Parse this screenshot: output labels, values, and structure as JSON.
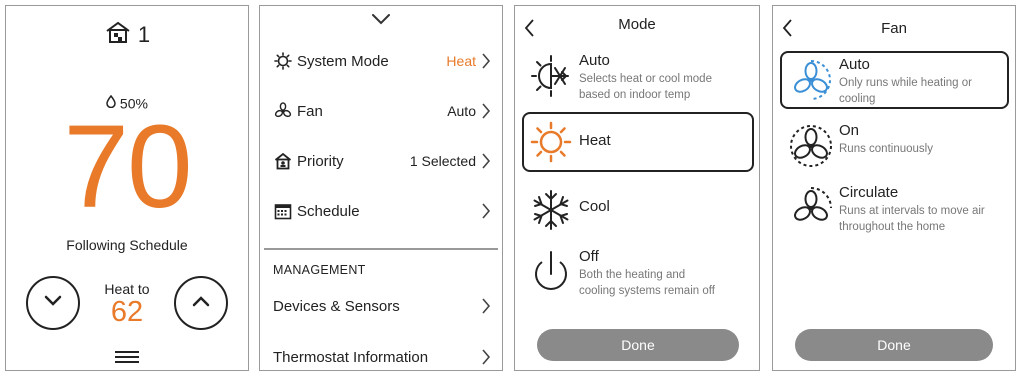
{
  "home": {
    "zone_number": "1",
    "humidity": "50%",
    "temperature": "70",
    "schedule_status": "Following Schedule",
    "mode_label": "Heat to",
    "setpoint": "62",
    "icons": [
      "home-zone-icon",
      "humidity-drop-icon",
      "chevron-down-icon",
      "chevron-up-icon",
      "menu-icon"
    ]
  },
  "settings": {
    "items": [
      {
        "label": "System Mode",
        "value": "Heat",
        "icon": "sun-gear-icon"
      },
      {
        "label": "Fan",
        "value": "Auto",
        "icon": "fan-icon"
      },
      {
        "label": "Priority",
        "value": "1 Selected",
        "icon": "home-priority-icon"
      },
      {
        "label": "Schedule",
        "value": "",
        "icon": "calendar-icon"
      }
    ],
    "section_header": "MANAGEMENT",
    "management_items": [
      {
        "label": "Devices & Sensors"
      },
      {
        "label": "Thermostat Information"
      }
    ]
  },
  "mode": {
    "title": "Mode",
    "selected": "Heat",
    "options": [
      {
        "name": "Auto",
        "desc_line1": "Selects heat or cool mode",
        "desc_line2": "based on indoor temp",
        "icon": "auto-mode-icon"
      },
      {
        "name": "Heat",
        "desc_line1": "",
        "desc_line2": "",
        "icon": "sun-icon"
      },
      {
        "name": "Cool",
        "desc_line1": "",
        "desc_line2": "",
        "icon": "snowflake-icon"
      },
      {
        "name": "Off",
        "desc_line1": "Both the heating and",
        "desc_line2": "cooling systems remain off",
        "icon": "power-icon"
      }
    ],
    "done_label": "Done"
  },
  "fan": {
    "title": "Fan",
    "selected": "Auto",
    "options": [
      {
        "name": "Auto",
        "desc_line1": "Only runs while heating or",
        "desc_line2": "cooling",
        "icon": "fan-auto-icon"
      },
      {
        "name": "On",
        "desc_line1": "Runs continuously",
        "desc_line2": "",
        "icon": "fan-on-icon"
      },
      {
        "name": "Circulate",
        "desc_line1": "Runs at intervals to move air",
        "desc_line2": "throughout the home",
        "icon": "fan-circulate-icon"
      }
    ],
    "done_label": "Done"
  },
  "colors": {
    "accent_orange": "#e87a2a",
    "fan_blue": "#3a8fd6",
    "done_gray": "#8a8a8a"
  }
}
